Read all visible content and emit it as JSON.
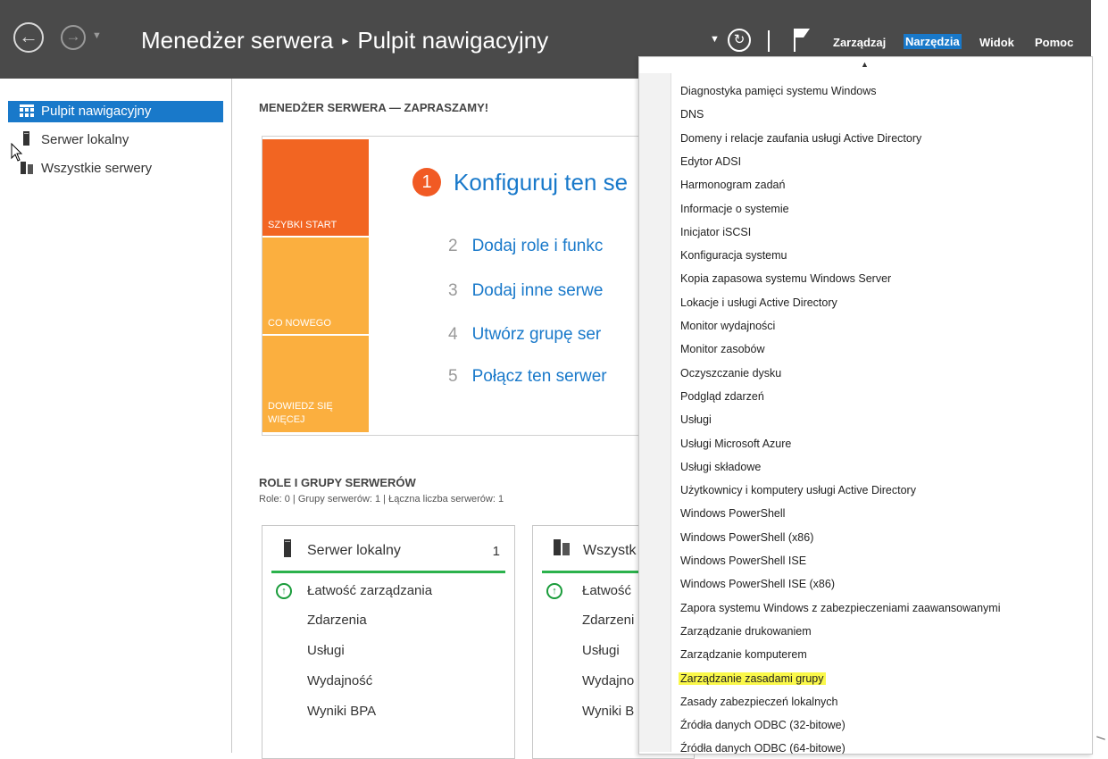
{
  "header": {
    "app_title": "Menedżer serwera",
    "separator": "▸",
    "page_title": "Pulpit nawigacyjny",
    "menu": {
      "manage": "Zarządzaj",
      "tools": "Narzędzia",
      "view": "Widok",
      "help": "Pomoc"
    }
  },
  "sidebar": {
    "items": [
      {
        "label": "Pulpit nawigacyjny",
        "icon": "dashboard-icon",
        "active": true
      },
      {
        "label": "Serwer lokalny",
        "icon": "server-icon",
        "active": false
      },
      {
        "label": "Wszystkie serwery",
        "icon": "servers-icon",
        "active": false
      }
    ]
  },
  "welcome": {
    "heading": "MENEDŻER SERWERA — ZAPRASZAMY!",
    "tiles": [
      {
        "label": "SZYBKI START",
        "color": "#f26522"
      },
      {
        "label": "CO NOWEGO",
        "color": "#fbaf3f"
      },
      {
        "label": "DOWIEDZ SIĘ WIĘCEJ",
        "color": "#fbaf3f"
      }
    ],
    "steps": [
      {
        "num": "1",
        "label": "Konfiguruj ten se"
      },
      {
        "num": "2",
        "label": "Dodaj role i funkc"
      },
      {
        "num": "3",
        "label": "Dodaj inne serwe"
      },
      {
        "num": "4",
        "label": "Utwórz grupę ser"
      },
      {
        "num": "5",
        "label": "Połącz ten serwer"
      }
    ]
  },
  "roles": {
    "heading": "ROLE I GRUPY SERWERÓW",
    "summary": "Role: 0 | Grupy serwerów: 1 | Łączna liczba serwerów: 1",
    "cards": [
      {
        "title": "Serwer lokalny",
        "count": "1",
        "rows": [
          "Łatwość zarządzania",
          "Zdarzenia",
          "Usługi",
          "Wydajność",
          "Wyniki BPA"
        ]
      },
      {
        "title": "Wszystk",
        "count": "",
        "rows": [
          "Łatwość",
          "Zdarzeni",
          "Usługi",
          "Wydajno",
          "Wyniki B"
        ]
      }
    ]
  },
  "tools_menu": {
    "items": [
      "Diagnostyka pamięci systemu Windows",
      "DNS",
      "Domeny i relacje zaufania usługi Active Directory",
      "Edytor ADSI",
      "Harmonogram zadań",
      "Informacje o systemie",
      "Inicjator iSCSI",
      "Konfiguracja systemu",
      "Kopia zapasowa systemu Windows Server",
      "Lokacje i usługi Active Directory",
      "Monitor wydajności",
      "Monitor zasobów",
      "Oczyszczanie dysku",
      "Podgląd zdarzeń",
      "Usługi",
      "Usługi Microsoft Azure",
      "Usługi składowe",
      "Użytkownicy i komputery usługi Active Directory",
      "Windows PowerShell",
      "Windows PowerShell (x86)",
      "Windows PowerShell ISE",
      "Windows PowerShell ISE (x86)",
      "Zapora systemu Windows z zabezpieczeniami zaawansowanymi",
      "Zarządzanie drukowaniem",
      "Zarządzanie komputerem",
      "Zarządzanie zasadami grupy",
      "Zasady zabezpieczeń lokalnych",
      "Źródła danych ODBC (32-bitowe)",
      "Źródła danych ODBC (64-bitowe)"
    ],
    "highlighted_item": "Zarządzanie zasadami grupy",
    "highlight_color": "#faf84a"
  },
  "colors": {
    "topbar": "#4a4a4a",
    "accent": "#1979ca",
    "status_green": "#2bb24c"
  }
}
